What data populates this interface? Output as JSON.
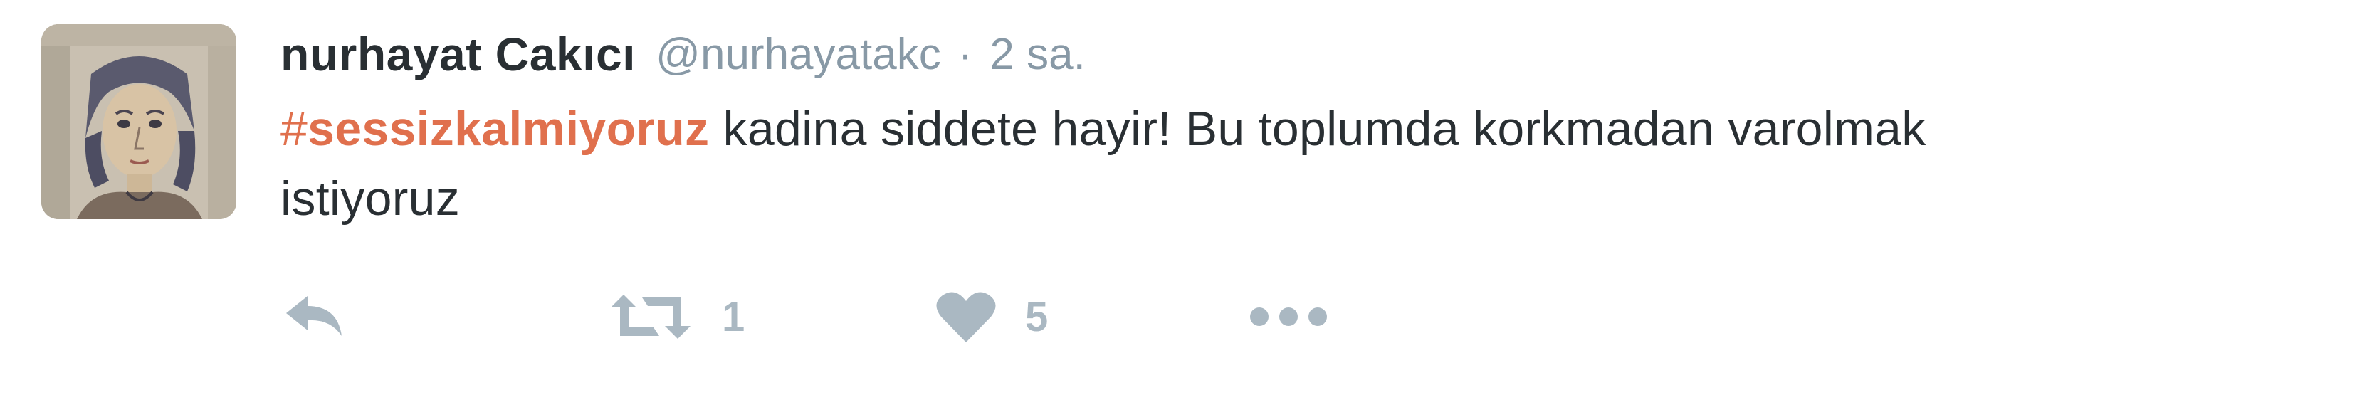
{
  "tweet": {
    "fullname": "nurhayat Cakıcı",
    "username": "@nurhayatakc",
    "separator": "·",
    "time": "2 sa.",
    "text": {
      "hashtag_symbol": "#",
      "hashtag_word": "sessizkalmiyoruz",
      "line1_rest": " kadina siddete hayir! Bu toplumda korkmadan varolmak",
      "line2": "istiyoruz"
    },
    "actions": {
      "reply": {
        "icon": "reply-icon"
      },
      "retweet": {
        "icon": "retweet-icon",
        "count": "1"
      },
      "like": {
        "icon": "heart-icon",
        "count": "5"
      },
      "more": {
        "icon": "more-dots-icon"
      }
    }
  },
  "colors": {
    "name": "#292f33",
    "meta": "#8899a6",
    "hashtag": "#e0704d",
    "action_icon": "#aab8c2"
  }
}
